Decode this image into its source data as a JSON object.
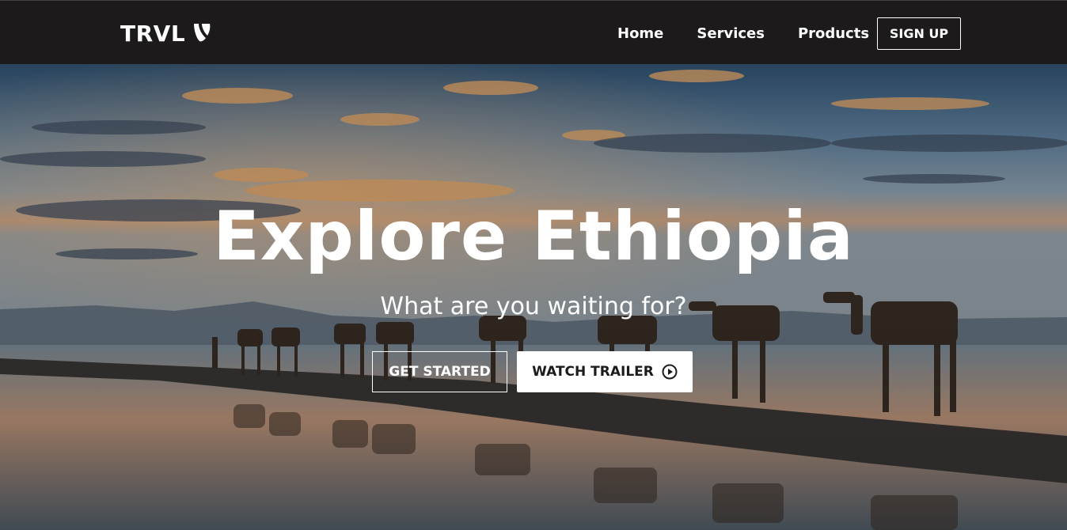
{
  "navbar": {
    "logo_text": "TRVL",
    "links": [
      "Home",
      "Services",
      "Products"
    ],
    "signup_label": "SIGN UP"
  },
  "hero": {
    "title": "Explore Ethiopia",
    "subtitle": "What are you waiting for?",
    "primary_button": "GET STARTED",
    "secondary_button": "WATCH TRAILER",
    "secondary_icon": "play-circle-icon"
  },
  "colors": {
    "navbar_bg": "#1c1a1a",
    "text": "#ffffff",
    "button_solid_bg": "#ffffff",
    "button_solid_text": "#1c1a1a"
  }
}
